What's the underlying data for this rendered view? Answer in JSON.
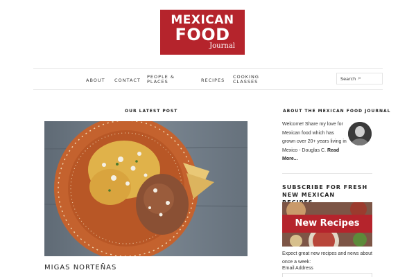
{
  "logo": {
    "line1": "MEXICAN",
    "line2": "FOOD",
    "line3": "Journal"
  },
  "nav": {
    "items": [
      {
        "label": "ABOUT"
      },
      {
        "label": "CONTACT"
      },
      {
        "label_line1": "PEOPLE &",
        "label_line2": "PLACES"
      },
      {
        "label": "RECIPES"
      },
      {
        "label_line1": "COOKING",
        "label_line2": "CLASSES"
      }
    ],
    "search_label": "Search"
  },
  "main": {
    "section_title": "OUR LATEST POST",
    "post_title": "MIGAS NORTEÑAS"
  },
  "sidebar": {
    "about_title": "ABOUT THE MEXICAN FOOD JOURNAL",
    "about_text": "Welcome! Share my love for Mexican food which has grown over 20+ years living in Mexico - Douglas C.",
    "read_more": "Read More...",
    "subscribe_title": "SUBSCRIBE FOR FRESH NEW MEXICAN RECIPES...",
    "banner_text": "New Recipes",
    "expect_text": "Expect great new recipes and news about once a week:",
    "email_label": "Email Address"
  }
}
